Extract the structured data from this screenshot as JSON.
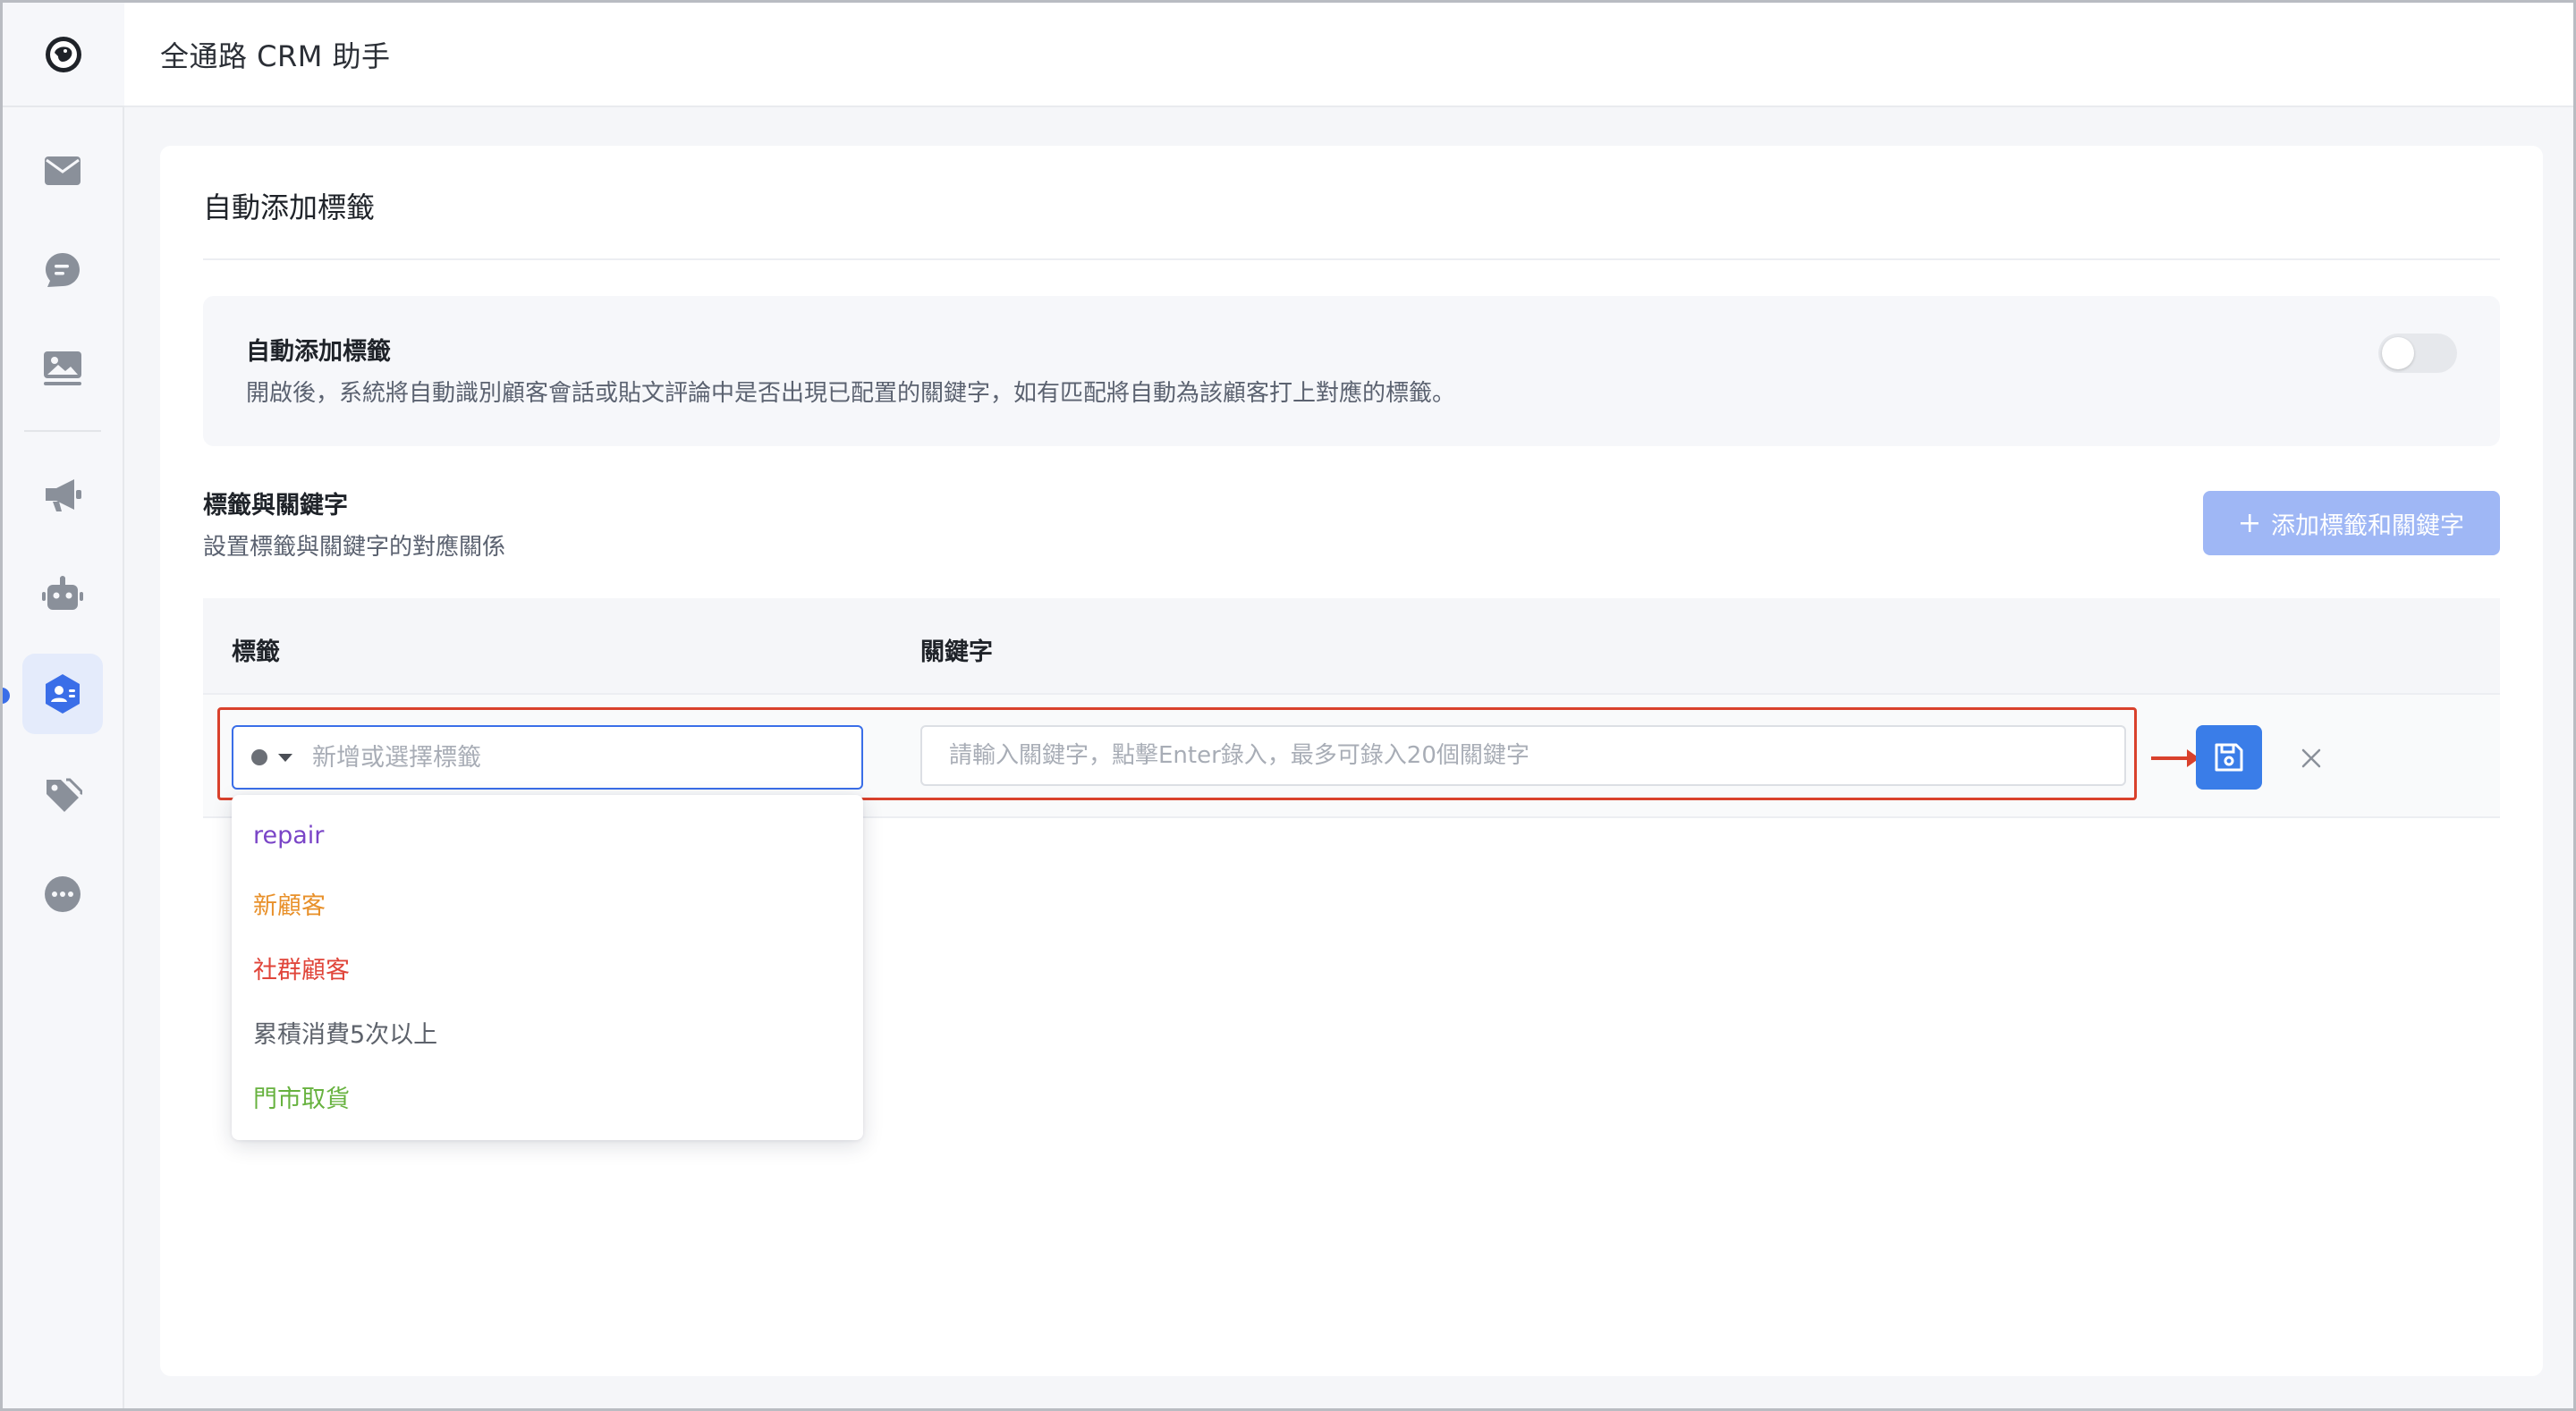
{
  "app": {
    "title": "全通路 CRM 助手"
  },
  "sidebar": {
    "items": [
      {
        "icon": "mail-icon"
      },
      {
        "icon": "chat-icon"
      },
      {
        "icon": "image-icon"
      },
      {
        "icon": "megaphone-icon"
      },
      {
        "icon": "robot-icon"
      },
      {
        "icon": "customer-tag-icon",
        "active": true
      },
      {
        "icon": "tags-icon"
      },
      {
        "icon": "more-icon"
      }
    ]
  },
  "card": {
    "title": "自動添加標籤",
    "auto_tag": {
      "title": "自動添加標籤",
      "description": "開啟後，系統將自動識別顧客會話或貼文評論中是否出現已配置的關鍵字，如有匹配將自動為該顧客打上對應的標籤。",
      "enabled": false
    },
    "section": {
      "title": "標籤與關鍵字",
      "description": "設置標籤與關鍵字的對應關係",
      "add_button": "添加標籤和關鍵字"
    },
    "table": {
      "columns": [
        "標籤",
        "關鍵字"
      ],
      "tag_placeholder": "新增或選擇標籤",
      "keyword_placeholder": "請輸入關鍵字，點擊Enter錄入，最多可錄入20個關鍵字"
    },
    "dropdown": {
      "options": [
        {
          "label": "repair",
          "color": "#7a45c7"
        },
        {
          "label": "新顧客",
          "color": "#e8902a"
        },
        {
          "label": "社群顧客",
          "color": "#e0453a"
        },
        {
          "label": "累積消費5次以上",
          "color": "#5d626b"
        },
        {
          "label": "門市取貨",
          "color": "#67b23f"
        }
      ]
    }
  },
  "colors": {
    "accent": "#3a7de8",
    "highlight": "#d9412c",
    "button_disabled": "#9fb7f5"
  }
}
